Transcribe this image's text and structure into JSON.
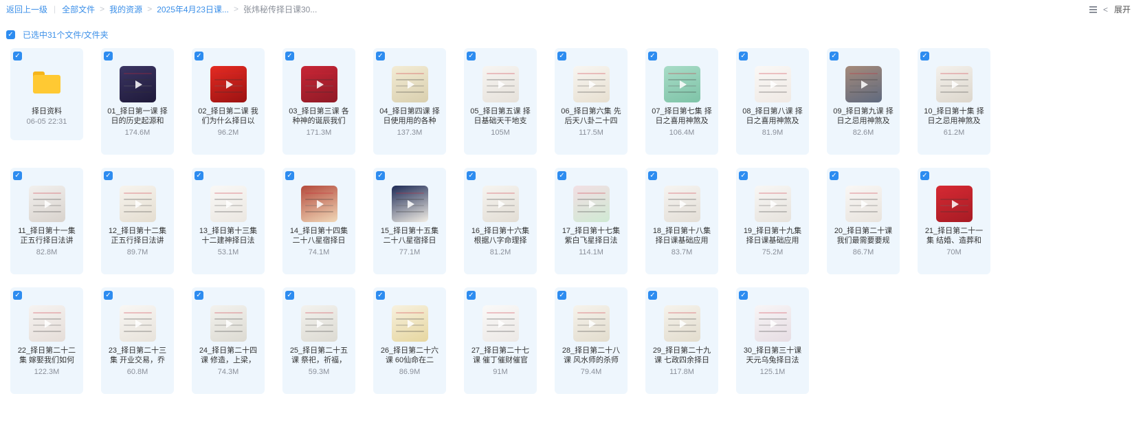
{
  "breadcrumb": {
    "back": "返回上一级",
    "items": [
      "全部文件",
      "我的资源",
      "2025年4月23日课...",
      "张炜秘传择日课30..."
    ]
  },
  "toolbar": {
    "expand": "展开"
  },
  "selection": {
    "text": "已选中31个文件/文件夹"
  },
  "colors": {
    "accent": "#2d8cf0",
    "card_bg": "#eef6fd",
    "folder": "#ffc933"
  },
  "files": [
    {
      "name": "择日资料",
      "meta": "06-05 22:31",
      "type": "folder"
    },
    {
      "name": "01_择日第一课 择日的历史起源和",
      "meta": "174.6M",
      "type": "video",
      "thumb": [
        "#3b3563",
        "#1f1a3a"
      ]
    },
    {
      "name": "02_择日第二课 我们为什么择日以",
      "meta": "96.2M",
      "type": "video",
      "thumb": [
        "#e52b22",
        "#9b1212"
      ]
    },
    {
      "name": "03_择日第三课 各种神的诞辰我们",
      "meta": "171.3M",
      "type": "video",
      "thumb": [
        "#c82636",
        "#8f1a26"
      ]
    },
    {
      "name": "04_择日第四课 择日使用用的各种",
      "meta": "137.3M",
      "type": "video",
      "thumb": [
        "#f3ecd5",
        "#d9cfae"
      ]
    },
    {
      "name": "05_择日第五课 择日基础天干地支",
      "meta": "105M",
      "type": "video",
      "thumb": [
        "#f7f5f2",
        "#e6e1da"
      ]
    },
    {
      "name": "06_择日第六集 先后天八卦二十四",
      "meta": "117.5M",
      "type": "video",
      "thumb": [
        "#f8f6f2",
        "#e7dfd0"
      ]
    },
    {
      "name": "07_择日第七集 择日之喜用神煞及",
      "meta": "106.4M",
      "type": "video",
      "thumb": [
        "#a8dcc7",
        "#7ec3a7"
      ]
    },
    {
      "name": "08_择日第八课 择日之喜用神煞及",
      "meta": "81.9M",
      "type": "video",
      "thumb": [
        "#faf8f6",
        "#efe9e4"
      ]
    },
    {
      "name": "09_择日第九课 择日之忌用神煞及",
      "meta": "82.6M",
      "type": "video",
      "thumb": [
        "#a58a7a",
        "#5f6a7f"
      ]
    },
    {
      "name": "10_择日第十集 择日之忌用神煞及",
      "meta": "61.2M",
      "type": "video",
      "thumb": [
        "#f4f1ec",
        "#dcd6cc"
      ]
    },
    {
      "name": "11_择日第十一集 正五行择日法讲",
      "meta": "82.8M",
      "type": "video",
      "thumb": [
        "#f2f0ee",
        "#d8d2cc"
      ]
    },
    {
      "name": "12_择日第十二集 正五行择日法讲",
      "meta": "89.7M",
      "type": "video",
      "thumb": [
        "#f7f4ee",
        "#e4ddd0"
      ]
    },
    {
      "name": "13_择日第十三集 十二建神择日法",
      "meta": "53.1M",
      "type": "video",
      "thumb": [
        "#f9f8f6",
        "#ebe7e1"
      ]
    },
    {
      "name": "14_择日第十四集 二十八星宿择日",
      "meta": "74.1M",
      "type": "video",
      "thumb": [
        "#b44a3c",
        "#f0d8b8"
      ]
    },
    {
      "name": "15_择日第十五集 二十八星宿择日",
      "meta": "77.1M",
      "type": "video",
      "thumb": [
        "#1d2a55",
        "#f3efe6"
      ]
    },
    {
      "name": "16_择日第十六集 根据八字命理择",
      "meta": "81.2M",
      "type": "video",
      "thumb": [
        "#f6f4f0",
        "#e2ddd4"
      ]
    },
    {
      "name": "17_择日第十七集 紫白飞星择日法",
      "meta": "114.1M",
      "type": "video",
      "thumb": [
        "#f2dfe4",
        "#cfe9d3"
      ]
    },
    {
      "name": "18_择日第十八集 择日课基础应用",
      "meta": "83.7M",
      "type": "video",
      "thumb": [
        "#f6f4f1",
        "#e3ded6"
      ]
    },
    {
      "name": "19_择日第十九集 择日课基础应用",
      "meta": "75.2M",
      "type": "video",
      "thumb": [
        "#f8f7f5",
        "#e6e2dc"
      ]
    },
    {
      "name": "20_择日第二十课 我们最需要要规",
      "meta": "86.7M",
      "type": "video",
      "thumb": [
        "#f9f7f5",
        "#e8e3dd"
      ]
    },
    {
      "name": "21_择日第二十一集 结婚、造葬和",
      "meta": "70M",
      "type": "video",
      "thumb": [
        "#d62a33",
        "#a71b24"
      ]
    },
    {
      "name": "22_择日第二十二集 嫁娶我们如何",
      "meta": "122.3M",
      "type": "video",
      "thumb": [
        "#f6f3f1",
        "#e5ddd8"
      ]
    },
    {
      "name": "23_择日第二十三集 开业交易，乔",
      "meta": "60.8M",
      "type": "video",
      "thumb": [
        "#f9f7f4",
        "#e7e2da"
      ]
    },
    {
      "name": "24_择日第二十四课 修造，上梁，",
      "meta": "74.3M",
      "type": "video",
      "thumb": [
        "#f3f2ee",
        "#dcdad2"
      ]
    },
    {
      "name": "25_择日第二十五课 祭祀，祈福，",
      "meta": "59.3M",
      "type": "video",
      "thumb": [
        "#f3f2ee",
        "#dcdad2"
      ]
    },
    {
      "name": "26_择日第二十六课 60仙命在二",
      "meta": "86.9M",
      "type": "video",
      "thumb": [
        "#f7f1df",
        "#e6d69f"
      ]
    },
    {
      "name": "27_择日第二十七课 催丁催财催官",
      "meta": "91M",
      "type": "video",
      "thumb": [
        "#faf9f8",
        "#ece8e5"
      ]
    },
    {
      "name": "28_择日第二十八课 风水师的杀师",
      "meta": "79.4M",
      "type": "video",
      "thumb": [
        "#f6f3ec",
        "#e2dccd"
      ]
    },
    {
      "name": "29_择日第二十九课 七政四余择日",
      "meta": "117.8M",
      "type": "video",
      "thumb": [
        "#f6f3ec",
        "#e2dccd"
      ]
    },
    {
      "name": "30_择日第三十课 天元乌兔择日法",
      "meta": "125.1M",
      "type": "video",
      "thumb": [
        "#f8f5f6",
        "#e6dde3"
      ]
    }
  ]
}
